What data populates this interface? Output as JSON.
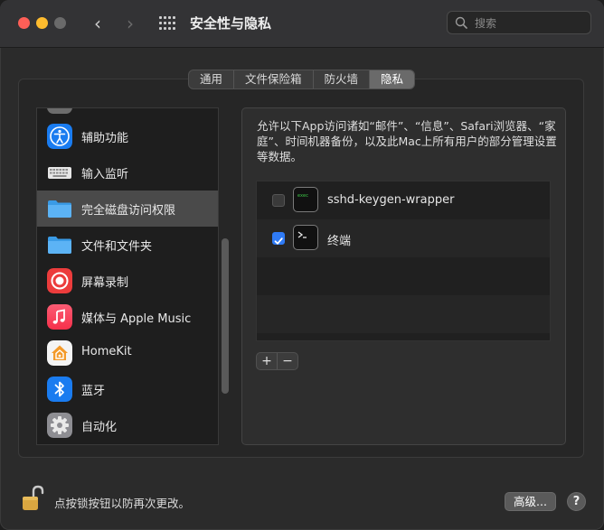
{
  "window": {
    "title": "安全性与隐私"
  },
  "search": {
    "placeholder": "搜索"
  },
  "tabs": [
    {
      "label": "通用",
      "active": false
    },
    {
      "label": "文件保险箱",
      "active": false
    },
    {
      "label": "防火墙",
      "active": false
    },
    {
      "label": "隐私",
      "active": true
    }
  ],
  "sidebar": {
    "items": [
      {
        "label": "辅助功能",
        "icon": "accessibility-icon"
      },
      {
        "label": "输入监听",
        "icon": "keyboard-icon"
      },
      {
        "label": "完全磁盘访问权限",
        "icon": "folder-icon",
        "selected": true
      },
      {
        "label": "文件和文件夹",
        "icon": "folder-icon"
      },
      {
        "label": "屏幕录制",
        "icon": "screen-recording-icon"
      },
      {
        "label": "媒体与 Apple Music",
        "icon": "music-icon"
      },
      {
        "label": "HomeKit",
        "icon": "home-icon"
      },
      {
        "label": "蓝牙",
        "icon": "bluetooth-icon"
      },
      {
        "label": "自动化",
        "icon": "gear-icon"
      }
    ]
  },
  "main": {
    "description": "允许以下App访问诸如“邮件”、“信息”、Safari浏览器、“家庭”、时间机器备份，以及此Mac上所有用户的部分管理设置等数据。",
    "apps": [
      {
        "name": "sshd-keygen-wrapper",
        "checked": false,
        "icon": "terminal-exec-icon"
      },
      {
        "name": "终端",
        "checked": true,
        "icon": "terminal-icon"
      }
    ],
    "add_label": "+",
    "remove_label": "−"
  },
  "footer": {
    "lock_text": "点按锁按钮以防再次更改。",
    "advanced_label": "高级...",
    "help_label": "?"
  },
  "colors": {
    "accent": "#2f7bf6",
    "close": "#ff5f57",
    "minimize": "#febc2e"
  }
}
